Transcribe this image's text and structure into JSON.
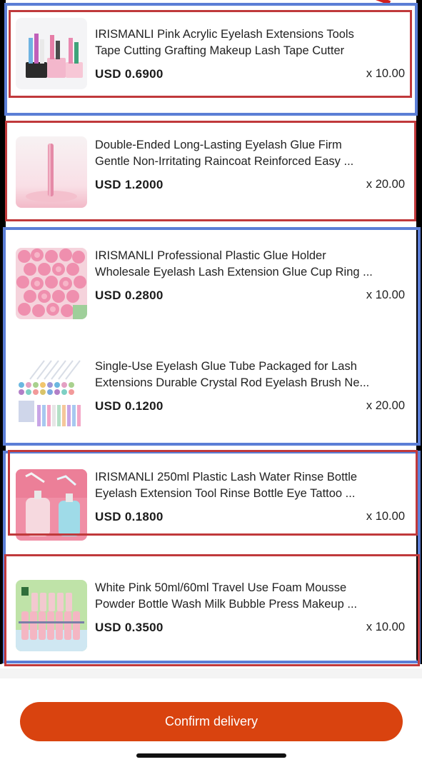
{
  "products": [
    {
      "title_line1": "IRISMANLI Pink Acrylic Eyelash Extensions Tools",
      "title_line2": "Tape Cutting Grafting Makeup Lash Tape Cutter",
      "price": "USD 0.6900",
      "qty": "x 10.00",
      "thumb_icon": "pink-acrylic-organizer-image"
    },
    {
      "title_line1": "Double-Ended Long-Lasting Eyelash Glue Firm",
      "title_line2": "Gentle Non-Irritating Raincoat Reinforced Easy ...",
      "price": "USD 1.2000",
      "qty": "x 20.00",
      "thumb_icon": "glue-tube-image"
    },
    {
      "title_line1": "IRISMANLI Professional Plastic Glue Holder",
      "title_line2": "Wholesale Eyelash Lash Extension Glue Cup Ring ...",
      "price": "USD 0.2800",
      "qty": "x 10.00",
      "thumb_icon": "pink-glue-rings-image"
    },
    {
      "title_line1": "Single-Use Eyelash Glue Tube Packaged for Lash",
      "title_line2": "Extensions Durable Crystal Rod Eyelash Brush Ne...",
      "price": "USD 0.1200",
      "qty": "x 20.00",
      "thumb_icon": "glue-tubes-brushes-image"
    },
    {
      "title_line1": "IRISMANLI  250ml Plastic Lash Water Rinse Bottle",
      "title_line2": "Eyelash Extension Tool Rinse Bottle Eye Tattoo ...",
      "price": "USD 0.1800",
      "qty": "x 10.00",
      "thumb_icon": "rinse-bottles-image"
    },
    {
      "title_line1": "White Pink 50ml/60ml Travel Use Foam Mousse",
      "title_line2": "Powder Bottle Wash Milk Bubble Press Makeup ...",
      "price": "USD 0.3500",
      "qty": "x 10.00",
      "thumb_icon": "foam-bottles-image"
    }
  ],
  "confirm_button_label": "Confirm delivery",
  "colors": {
    "accent": "#d9430f",
    "annotation_blue": "#5b7ed6",
    "annotation_red": "#c0393b"
  }
}
